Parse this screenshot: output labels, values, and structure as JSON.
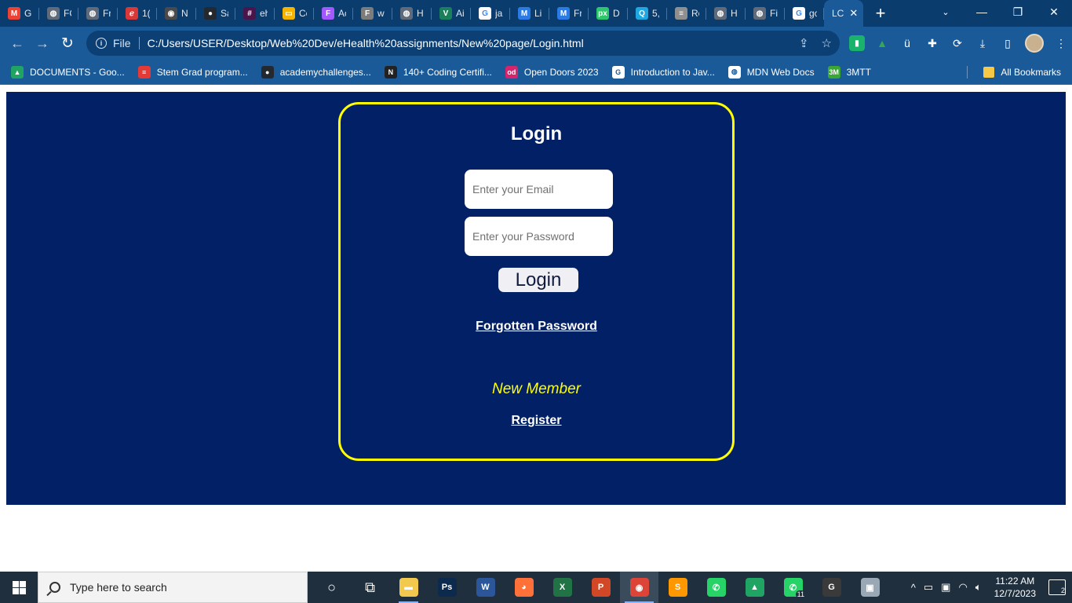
{
  "browser": {
    "tabs": [
      {
        "title": "Gi",
        "icon": "gmail-icon",
        "color": "#ea4335",
        "glyph": "M"
      },
      {
        "title": "FC",
        "icon": "globe-icon",
        "color": "#5f6b7a",
        "glyph": "◍"
      },
      {
        "title": "Fr",
        "icon": "globe-icon",
        "color": "#5f6b7a",
        "glyph": "◍"
      },
      {
        "title": "1(",
        "icon": "edge-legacy-icon",
        "color": "#d93838",
        "glyph": "ℯ"
      },
      {
        "title": "N",
        "icon": "chrome-icon",
        "color": "#4a4a4a",
        "glyph": "◉"
      },
      {
        "title": "Sa",
        "icon": "github-icon",
        "color": "#24292f",
        "glyph": "●"
      },
      {
        "title": "eh",
        "icon": "slack-icon",
        "color": "#4a154b",
        "glyph": "#"
      },
      {
        "title": "Cc",
        "icon": "slides-icon",
        "color": "#f4b400",
        "glyph": "▭"
      },
      {
        "title": "Ac",
        "icon": "figma-icon",
        "color": "#a259ff",
        "glyph": "F"
      },
      {
        "title": "w",
        "icon": "figma-icon",
        "color": "#7c7c7c",
        "glyph": "F"
      },
      {
        "title": "H",
        "icon": "globe-icon",
        "color": "#5f6b7a",
        "glyph": "◍"
      },
      {
        "title": "Ai",
        "icon": "vue-icon",
        "color": "#1b7f5b",
        "glyph": "V"
      },
      {
        "title": "ja",
        "icon": "google-icon",
        "color": "#ffffff",
        "glyph": "G"
      },
      {
        "title": "Li",
        "icon": "mdn-icon",
        "color": "#2c7be5",
        "glyph": "M"
      },
      {
        "title": "Fr",
        "icon": "mdn-icon",
        "color": "#2c7be5",
        "glyph": "M"
      },
      {
        "title": "D",
        "icon": "pixabay-icon",
        "color": "#2ec66d",
        "glyph": "px"
      },
      {
        "title": "5,",
        "icon": "search-q-icon",
        "color": "#1ea7e1",
        "glyph": "Q"
      },
      {
        "title": "Rc",
        "icon": "stack-icon",
        "color": "#8f8f8f",
        "glyph": "≡"
      },
      {
        "title": "H",
        "icon": "globe-icon",
        "color": "#5f6b7a",
        "glyph": "◍"
      },
      {
        "title": "Fi",
        "icon": "globe-icon",
        "color": "#5f6b7a",
        "glyph": "◍"
      },
      {
        "title": "gc",
        "icon": "google-icon",
        "color": "#ffffff",
        "glyph": "G"
      },
      {
        "title": "LC",
        "icon": "none",
        "color": "#1a5a98",
        "glyph": ""
      }
    ],
    "new_tab_glyph": "+",
    "address": {
      "scheme_label": "File",
      "url": "C:/Users/USER/Desktop/Web%20Dev/eHealth%20assignments/New%20page/Login.html"
    },
    "bookmarks": [
      {
        "label": "DOCUMENTS - Goo...",
        "icon": "google-drive-icon",
        "color": "#1fa463",
        "glyph": "▲"
      },
      {
        "label": "Stem Grad program...",
        "icon": "stack-icon",
        "color": "#e53935",
        "glyph": "≡"
      },
      {
        "label": "academychallenges...",
        "icon": "github-icon",
        "color": "#24292f",
        "glyph": "●"
      },
      {
        "label": "140+ Coding Certifi...",
        "icon": "notion-icon",
        "color": "#222222",
        "glyph": "N"
      },
      {
        "label": "Open Doors 2023",
        "icon": "opendoors-icon",
        "color": "#d6246e",
        "glyph": "od"
      },
      {
        "label": "Introduction to Jav...",
        "icon": "google-icon",
        "color": "#ffffff",
        "glyph": "G"
      },
      {
        "label": "MDN Web Docs",
        "icon": "globe-icon",
        "color": "#ffffff",
        "glyph": "◍"
      },
      {
        "label": "3MTT",
        "icon": "3mtt-icon",
        "color": "#3aa635",
        "glyph": "3M"
      }
    ],
    "all_bookmarks_label": "All Bookmarks"
  },
  "page": {
    "title": "Login",
    "email_placeholder": "Enter your Email",
    "password_placeholder": "Enter your Password",
    "login_button": "Login",
    "forgot_link": "Forgotten Password",
    "new_member_text": "New Member",
    "register_link": "Register",
    "colors": {
      "background": "#022066",
      "card_border": "#ffff00",
      "accent_text": "#ffff00"
    }
  },
  "taskbar": {
    "search_placeholder": "Type here to search",
    "apps": [
      {
        "name": "cortana-icon",
        "glyph": "○",
        "color": "transparent",
        "state": ""
      },
      {
        "name": "task-view-icon",
        "glyph": "⧉",
        "color": "transparent",
        "state": ""
      },
      {
        "name": "file-explorer-icon",
        "glyph": "▬",
        "color": "#f2c94c",
        "state": "running"
      },
      {
        "name": "photoshop-icon",
        "glyph": "Ps",
        "color": "#0c2a4d",
        "state": ""
      },
      {
        "name": "word-icon",
        "glyph": "W",
        "color": "#2b579a",
        "state": ""
      },
      {
        "name": "firefox-icon",
        "glyph": "◕",
        "color": "#ff7139",
        "state": ""
      },
      {
        "name": "excel-icon",
        "glyph": "X",
        "color": "#217346",
        "state": ""
      },
      {
        "name": "powerpoint-icon",
        "glyph": "P",
        "color": "#d24726",
        "state": ""
      },
      {
        "name": "chrome-icon",
        "glyph": "◉",
        "color": "#db4437",
        "state": "active"
      },
      {
        "name": "sublime-icon",
        "glyph": "S",
        "color": "#ff9800",
        "state": ""
      },
      {
        "name": "whatsapp-icon",
        "glyph": "✆",
        "color": "#25d366",
        "state": ""
      },
      {
        "name": "google-drive-icon",
        "glyph": "▲",
        "color": "#1fa463",
        "state": ""
      },
      {
        "name": "whatsapp-business-icon",
        "glyph": "✆",
        "color": "#25d366",
        "state": "",
        "badge": "11"
      },
      {
        "name": "app-g-icon",
        "glyph": "G",
        "color": "#3a3a3a",
        "state": ""
      },
      {
        "name": "image-viewer-icon",
        "glyph": "▣",
        "color": "#9aa7b4",
        "state": ""
      }
    ],
    "clock_time": "11:22 AM",
    "clock_date": "12/7/2023",
    "notification_count": "2"
  }
}
